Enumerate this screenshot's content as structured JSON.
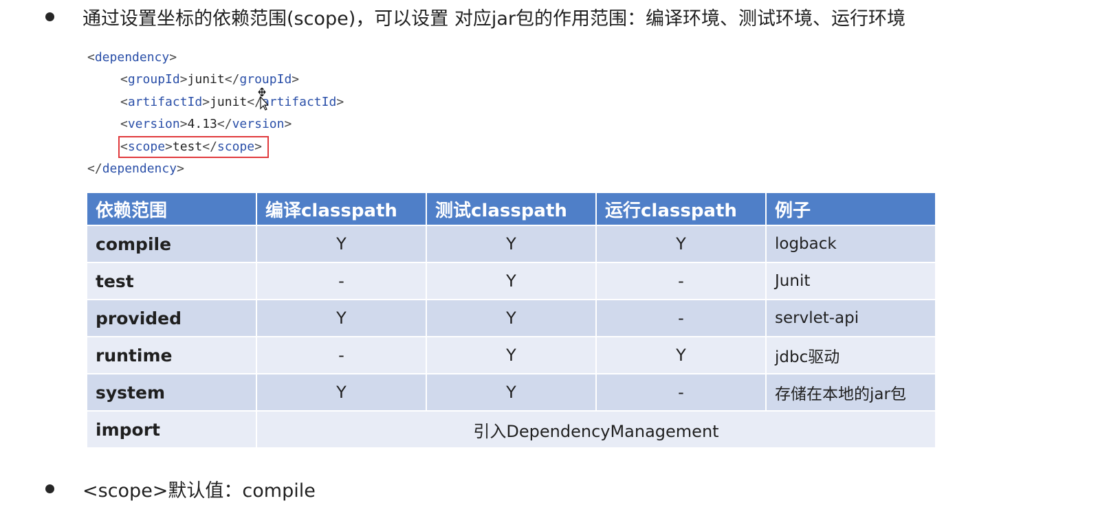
{
  "bullets": {
    "first": "通过设置坐标的依赖范围(scope)，可以设置 对应jar包的作用范围：编译环境、测试环境、运行环境",
    "second": "<scope>默认值：compile"
  },
  "code": {
    "open_tag": "dependency",
    "groupId_tag": "groupId",
    "groupId_value": "junit",
    "artifactId_tag": "artifactId",
    "artifactId_value": "junit",
    "version_tag": "version",
    "version_value": "4.13",
    "scope_tag": "scope",
    "scope_value": "test",
    "close_tag": "dependency"
  },
  "table": {
    "headers": [
      "依赖范围",
      "编译classpath",
      "测试classpath",
      "运行classpath",
      "例子"
    ],
    "rows": [
      {
        "scope": "compile",
        "compile": "Y",
        "test": "Y",
        "runtime": "Y",
        "example": "logback"
      },
      {
        "scope": "test",
        "compile": "-",
        "test": "Y",
        "runtime": "-",
        "example": "Junit"
      },
      {
        "scope": "provided",
        "compile": "Y",
        "test": "Y",
        "runtime": "-",
        "example": "servlet-api"
      },
      {
        "scope": "runtime",
        "compile": "-",
        "test": "Y",
        "runtime": "Y",
        "example": "jdbc驱动"
      },
      {
        "scope": "system",
        "compile": "Y",
        "test": "Y",
        "runtime": "-",
        "example": "存储在本地的jar包"
      }
    ],
    "import_row": {
      "scope": "import",
      "description": "引入DependencyManagement"
    }
  },
  "colors": {
    "header_bg": "#4f7fc8",
    "row_odd_bg": "#d0d9ec",
    "row_even_bg": "#e8ecf6",
    "tag_color": "#2a4fa8",
    "highlight_border": "#e0383b"
  }
}
